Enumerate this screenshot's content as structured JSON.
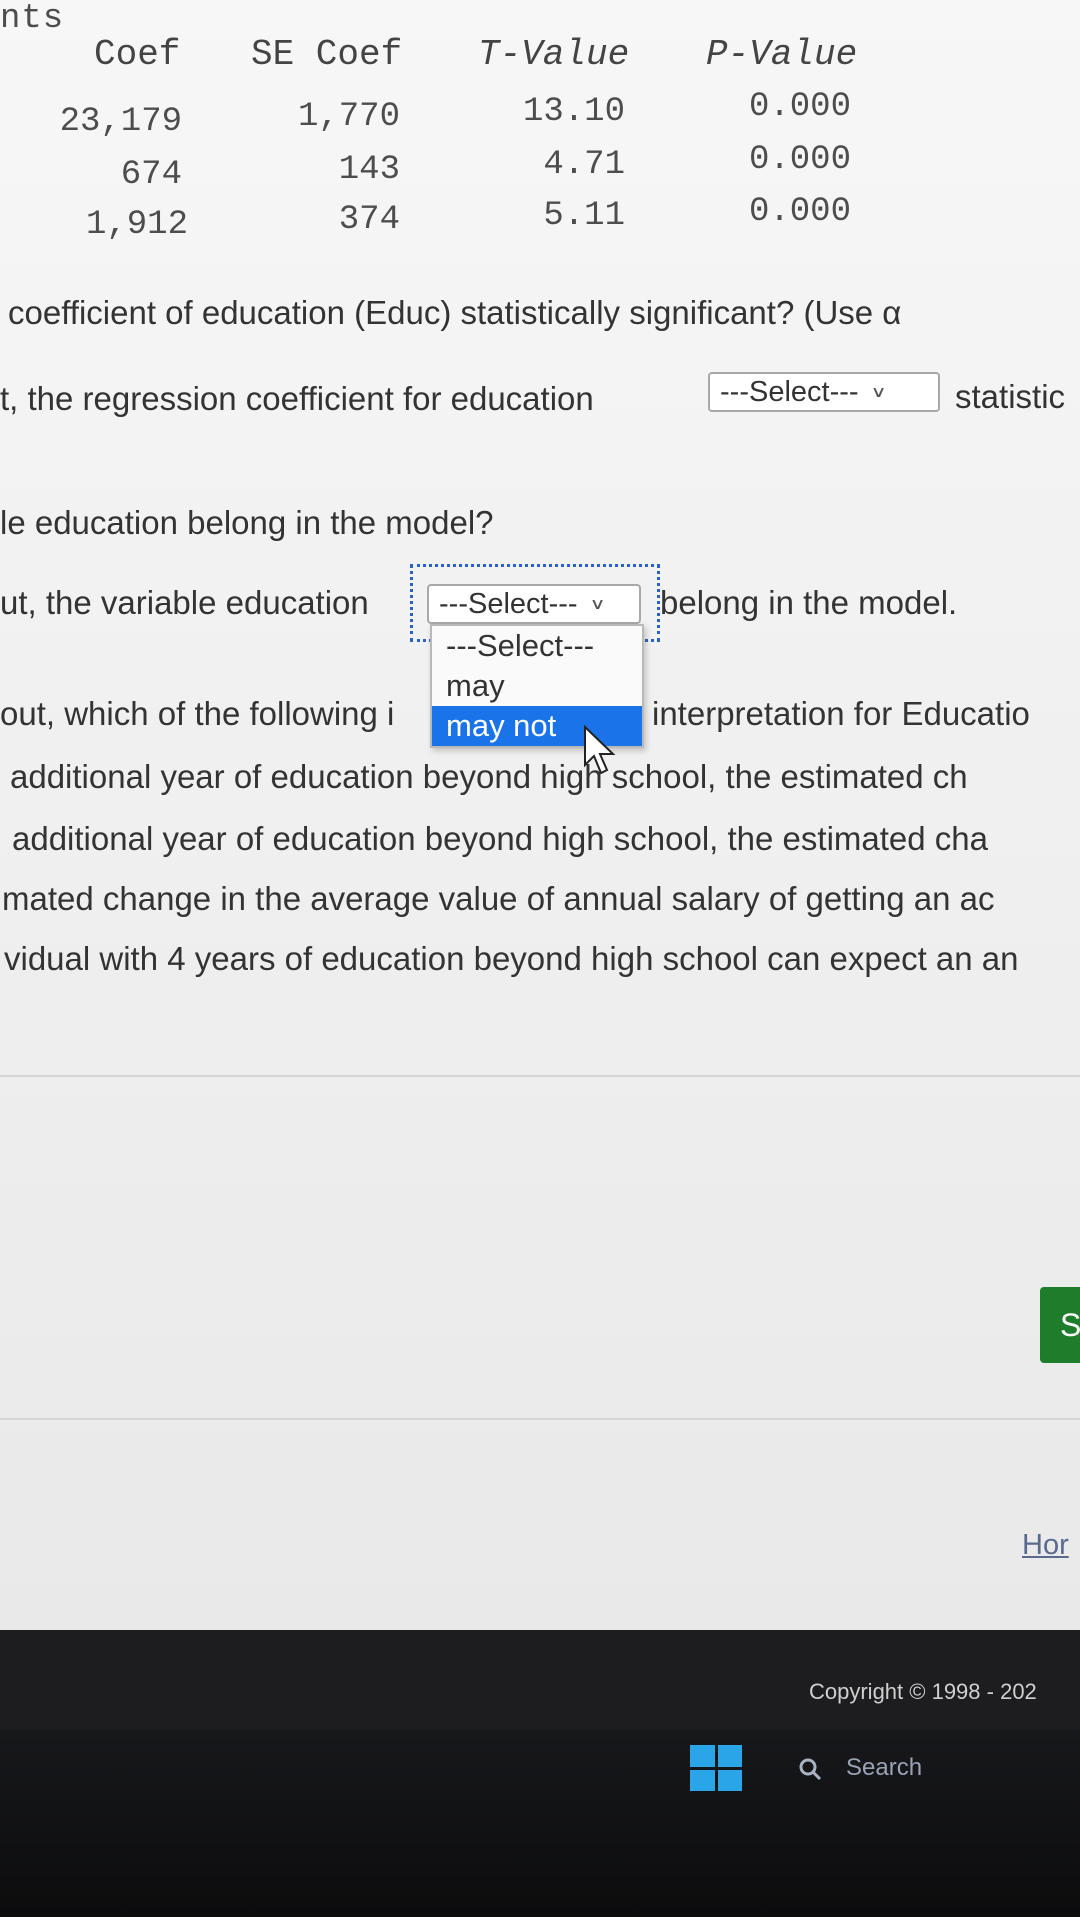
{
  "table": {
    "section_heading": "nts",
    "headers": [
      "Coef",
      "SE Coef",
      "T-Value",
      "P-Value"
    ],
    "rows": [
      [
        "23,179",
        "1,770",
        "13.10",
        "0.000"
      ],
      [
        "674",
        "143",
        "4.71",
        "0.000"
      ],
      [
        "1,912",
        "374",
        "5.11",
        "0.000"
      ]
    ]
  },
  "questions": {
    "q1_text": "coefficient of education (Educ) statistically significant? (Use α",
    "q1_answer_prefix": "t, the regression coefficient for education",
    "q1_answer_suffix": "statistic",
    "q1_select_value": "---Select---",
    "q2_text": "le education belong in the model?",
    "q2_answer_prefix": "ut, the variable education",
    "q2_select_value": "---Select---",
    "q2_answer_suffix": "belong in the model.",
    "q3_prefix": "out, which of the following i",
    "q3_suffix": "interpretation for Educatio",
    "options": [
      "additional year of education beyond high school, the estimated ch",
      "additional year of education beyond high school, the estimated cha",
      "mated change in the average value of annual salary of getting an ac",
      "vidual with 4 years of education beyond high school can expect an an"
    ]
  },
  "dropdown": {
    "options": [
      "---Select---",
      "may",
      "may not"
    ],
    "highlighted": "may not"
  },
  "submit_label": "S",
  "home_link": "Hor",
  "footer": {
    "copyright": "Copyright © 1998 - 202"
  },
  "taskbar": {
    "search_label": "Search"
  },
  "colors": {
    "dropdown_highlight": "#1a73e8",
    "submit_green": "#1e7d2a",
    "focus_ring": "#2a62c9"
  }
}
